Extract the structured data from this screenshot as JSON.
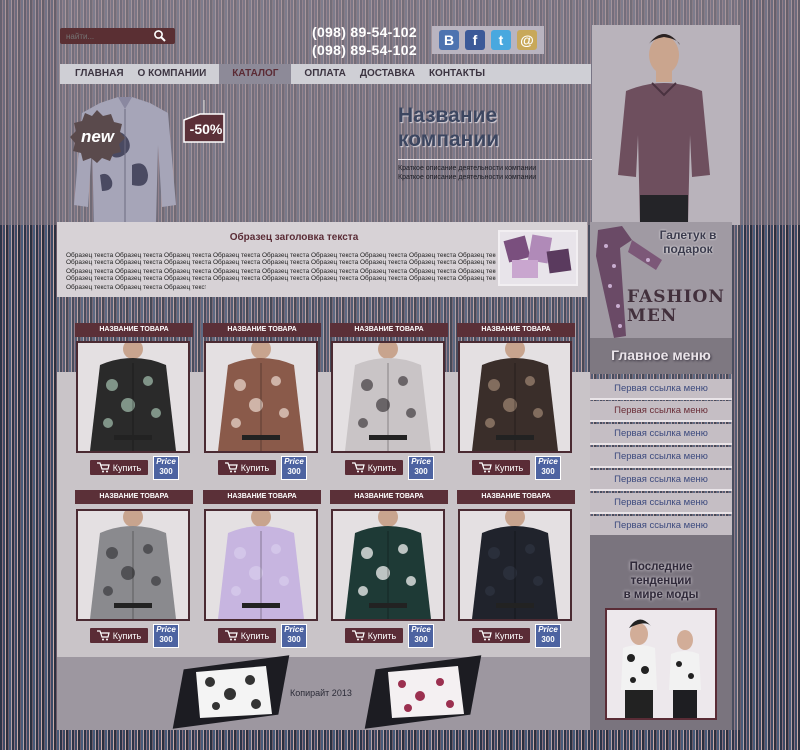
{
  "search": {
    "placeholder": "найти..."
  },
  "contacts": {
    "phone_1": "(098) 89-54-102",
    "phone_2": "(098) 89-54-102"
  },
  "socials": [
    {
      "name": "vkontakte",
      "glyph": "B",
      "color": "#4d73b0"
    },
    {
      "name": "facebook",
      "glyph": "f",
      "color": "#3b5998"
    },
    {
      "name": "twitter",
      "glyph": "t",
      "color": "#48a8df"
    },
    {
      "name": "email",
      "glyph": "@",
      "color": "#c8a85a"
    }
  ],
  "nav": [
    "ГЛАВНАЯ",
    "О КОМПАНИИ",
    "КАТАЛОГ",
    "ОПЛАТА",
    "ДОСТАВКА",
    "КОНТАКТЫ"
  ],
  "nav_active": "КАТАЛОГ",
  "hero": {
    "badge_new": "new",
    "sale": "-50%",
    "company_name_1": "Название",
    "company_name_2": "компании",
    "desc_1": "Краткое описание деятельности компании",
    "desc_2": "Краткое описание деятельности компании"
  },
  "text_block": {
    "title": "Образец заголовка текста",
    "line": "Образец текста Образец текста Образец текста Образец текста Образец текста Образец текста Образец текста Образец текста Образец текста"
  },
  "gift": {
    "line_1": "Галетук в",
    "line_2": "подарок"
  },
  "brand": {
    "line_1": "FASHION",
    "line_2": "MEN"
  },
  "menu": {
    "title": "Главное меню",
    "links": [
      "Первая ссылка меню",
      "Первая ссылка меню",
      "Первая ссылка меню",
      "Первая ссылка меню",
      "Первая ссылка меню",
      "Первая ссылка меню",
      "Первая ссылка меню"
    ]
  },
  "trends": {
    "line_1": "Последние",
    "line_2": "тенденции",
    "line_3": "в мире моды"
  },
  "products": [
    {
      "title": "НАЗВАНИЕ ТОВАРА",
      "buy": "Купить",
      "price_label": "Price",
      "price": "300",
      "shirt_color": "#2a2a2a",
      "pattern": "#9db8a8"
    },
    {
      "title": "НАЗВАНИЕ ТОВАРА",
      "buy": "Купить",
      "price_label": "Price",
      "price": "300",
      "shirt_color": "#8a5a4a",
      "pattern": "#e6d2c8"
    },
    {
      "title": "НАЗВАНИЕ ТОВАРА",
      "buy": "Купить",
      "price_label": "Price",
      "price": "300",
      "shirt_color": "#c9c4c6",
      "pattern": "#4a4448"
    },
    {
      "title": "НАЗВАНИЕ ТОВАРА",
      "buy": "Купить",
      "price_label": "Price",
      "price": "300",
      "shirt_color": "#3a2e2a",
      "pattern": "#9a8270"
    },
    {
      "title": "НАЗВАНИЕ ТОВАРА",
      "buy": "Купить",
      "price_label": "Price",
      "price": "300",
      "shirt_color": "#8a8a8e",
      "pattern": "#3e3e42"
    },
    {
      "title": "НАЗВАНИЕ ТОВАРА",
      "buy": "Купить",
      "price_label": "Price",
      "price": "300",
      "shirt_color": "#c7b5e0",
      "pattern": "#d8ccec"
    },
    {
      "title": "НАЗВАНИЕ ТОВАРА",
      "buy": "Купить",
      "price_label": "Price",
      "price": "300",
      "shirt_color": "#1e3a36",
      "pattern": "#f2f2f2"
    },
    {
      "title": "НАЗВАНИЕ ТОВАРА",
      "buy": "Купить",
      "price_label": "Price",
      "price": "300",
      "shirt_color": "#20232c",
      "pattern": "#2e3340"
    }
  ],
  "footer": {
    "copyright": "Копирайт 2013"
  }
}
